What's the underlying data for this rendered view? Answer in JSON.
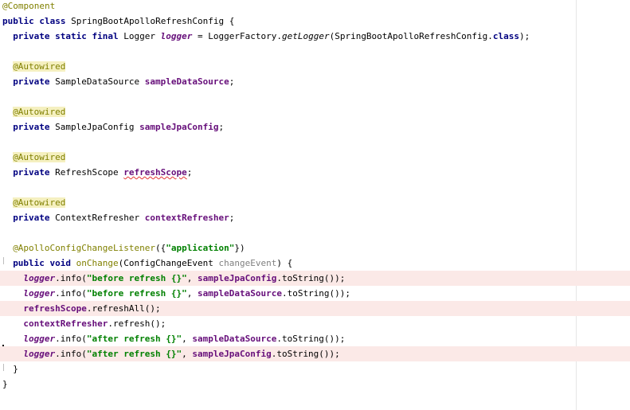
{
  "colors": {
    "keyword": "#000080",
    "annotation": "#808000",
    "field": "#660e7a",
    "string": "#008000",
    "highlight_line": "#fbe9e7",
    "annotation_bg": "#f5f0c0"
  },
  "lines": [
    {
      "indent": 0,
      "highlight": false,
      "tokens": [
        {
          "t": "@Component",
          "c": "ann"
        }
      ]
    },
    {
      "indent": 0,
      "highlight": false,
      "tokens": [
        {
          "t": "public class",
          "c": "kw"
        },
        {
          "t": " SpringBootApolloRefreshConfig {",
          "c": ""
        }
      ]
    },
    {
      "indent": 2,
      "highlight": false,
      "tokens": [
        {
          "t": "private static final",
          "c": "kw"
        },
        {
          "t": " Logger ",
          "c": ""
        },
        {
          "t": "logger",
          "c": "fld it"
        },
        {
          "t": " = LoggerFactory.",
          "c": ""
        },
        {
          "t": "getLogger",
          "c": "mth"
        },
        {
          "t": "(SpringBootApolloRefreshConfig.",
          "c": ""
        },
        {
          "t": "class",
          "c": "kw"
        },
        {
          "t": ");",
          "c": ""
        }
      ]
    },
    {
      "indent": 2,
      "highlight": false,
      "tokens": []
    },
    {
      "indent": 2,
      "highlight": false,
      "tokens": [
        {
          "t": "@Autowired",
          "c": "ann bg"
        }
      ]
    },
    {
      "indent": 2,
      "highlight": false,
      "tokens": [
        {
          "t": "private",
          "c": "kw"
        },
        {
          "t": " SampleDataSource ",
          "c": ""
        },
        {
          "t": "sampleDataSource",
          "c": "fld"
        },
        {
          "t": ";",
          "c": ""
        }
      ]
    },
    {
      "indent": 2,
      "highlight": false,
      "tokens": []
    },
    {
      "indent": 2,
      "highlight": false,
      "tokens": [
        {
          "t": "@Autowired",
          "c": "ann bg"
        }
      ]
    },
    {
      "indent": 2,
      "highlight": false,
      "tokens": [
        {
          "t": "private",
          "c": "kw"
        },
        {
          "t": " SampleJpaConfig ",
          "c": ""
        },
        {
          "t": "sampleJpaConfig",
          "c": "fld"
        },
        {
          "t": ";",
          "c": ""
        }
      ]
    },
    {
      "indent": 2,
      "highlight": false,
      "tokens": []
    },
    {
      "indent": 2,
      "highlight": false,
      "tokens": [
        {
          "t": "@Autowired",
          "c": "ann bg"
        }
      ]
    },
    {
      "indent": 2,
      "highlight": false,
      "tokens": [
        {
          "t": "private",
          "c": "kw"
        },
        {
          "t": " RefreshScope ",
          "c": ""
        },
        {
          "t": "refreshScope",
          "c": "fld wave"
        },
        {
          "t": ";",
          "c": ""
        }
      ]
    },
    {
      "indent": 2,
      "highlight": false,
      "tokens": []
    },
    {
      "indent": 2,
      "highlight": false,
      "tokens": [
        {
          "t": "@Autowired",
          "c": "ann bg"
        }
      ]
    },
    {
      "indent": 2,
      "highlight": false,
      "tokens": [
        {
          "t": "private",
          "c": "kw"
        },
        {
          "t": " ContextRefresher ",
          "c": ""
        },
        {
          "t": "contextRefresher",
          "c": "fld"
        },
        {
          "t": ";",
          "c": ""
        }
      ]
    },
    {
      "indent": 2,
      "highlight": false,
      "tokens": []
    },
    {
      "indent": 2,
      "highlight": false,
      "tokens": [
        {
          "t": "@ApolloConfigChangeListener",
          "c": "ann"
        },
        {
          "t": "({",
          "c": ""
        },
        {
          "t": "\"application\"",
          "c": "str"
        },
        {
          "t": "})",
          "c": ""
        }
      ]
    },
    {
      "indent": 2,
      "highlight": false,
      "tokens": [
        {
          "t": "public void",
          "c": "kw"
        },
        {
          "t": " onChange",
          "c": "ann"
        },
        {
          "t": "(ConfigChangeEvent ",
          "c": ""
        },
        {
          "t": "changeEvent",
          "c": "prm"
        },
        {
          "t": ") {",
          "c": ""
        }
      ]
    },
    {
      "indent": 4,
      "highlight": true,
      "tokens": [
        {
          "t": "logger",
          "c": "fld it"
        },
        {
          "t": ".info(",
          "c": ""
        },
        {
          "t": "\"before refresh {}\"",
          "c": "str"
        },
        {
          "t": ", ",
          "c": ""
        },
        {
          "t": "sampleJpaConfig",
          "c": "fld"
        },
        {
          "t": ".toString());",
          "c": ""
        }
      ]
    },
    {
      "indent": 4,
      "highlight": false,
      "tokens": [
        {
          "t": "logger",
          "c": "fld it"
        },
        {
          "t": ".info(",
          "c": ""
        },
        {
          "t": "\"before refresh {}\"",
          "c": "str"
        },
        {
          "t": ", ",
          "c": ""
        },
        {
          "t": "sampleDataSource",
          "c": "fld"
        },
        {
          "t": ".toString());",
          "c": ""
        }
      ]
    },
    {
      "indent": 4,
      "highlight": true,
      "tokens": [
        {
          "t": "refreshScope",
          "c": "fld"
        },
        {
          "t": ".refreshAll();",
          "c": ""
        }
      ]
    },
    {
      "indent": 4,
      "highlight": false,
      "tokens": [
        {
          "t": "contextRefresher",
          "c": "fld"
        },
        {
          "t": ".refresh();",
          "c": ""
        }
      ]
    },
    {
      "indent": 4,
      "highlight": false,
      "tokens": [
        {
          "t": "logger",
          "c": "fld it"
        },
        {
          "t": ".info(",
          "c": ""
        },
        {
          "t": "\"after refresh {}\"",
          "c": "str"
        },
        {
          "t": ", ",
          "c": ""
        },
        {
          "t": "sampleDataSource",
          "c": "fld"
        },
        {
          "t": ".toString());",
          "c": ""
        }
      ]
    },
    {
      "indent": 4,
      "highlight": true,
      "tokens": [
        {
          "t": "logger",
          "c": "fld it"
        },
        {
          "t": ".info(",
          "c": ""
        },
        {
          "t": "\"after refresh {}\"",
          "c": "str"
        },
        {
          "t": ", ",
          "c": ""
        },
        {
          "t": "sampleJpaConfig",
          "c": "fld"
        },
        {
          "t": ".toString());",
          "c": ""
        }
      ]
    },
    {
      "indent": 2,
      "highlight": false,
      "tokens": [
        {
          "t": "}",
          "c": ""
        }
      ]
    },
    {
      "indent": 0,
      "highlight": false,
      "tokens": [
        {
          "t": "}",
          "c": ""
        }
      ]
    }
  ]
}
